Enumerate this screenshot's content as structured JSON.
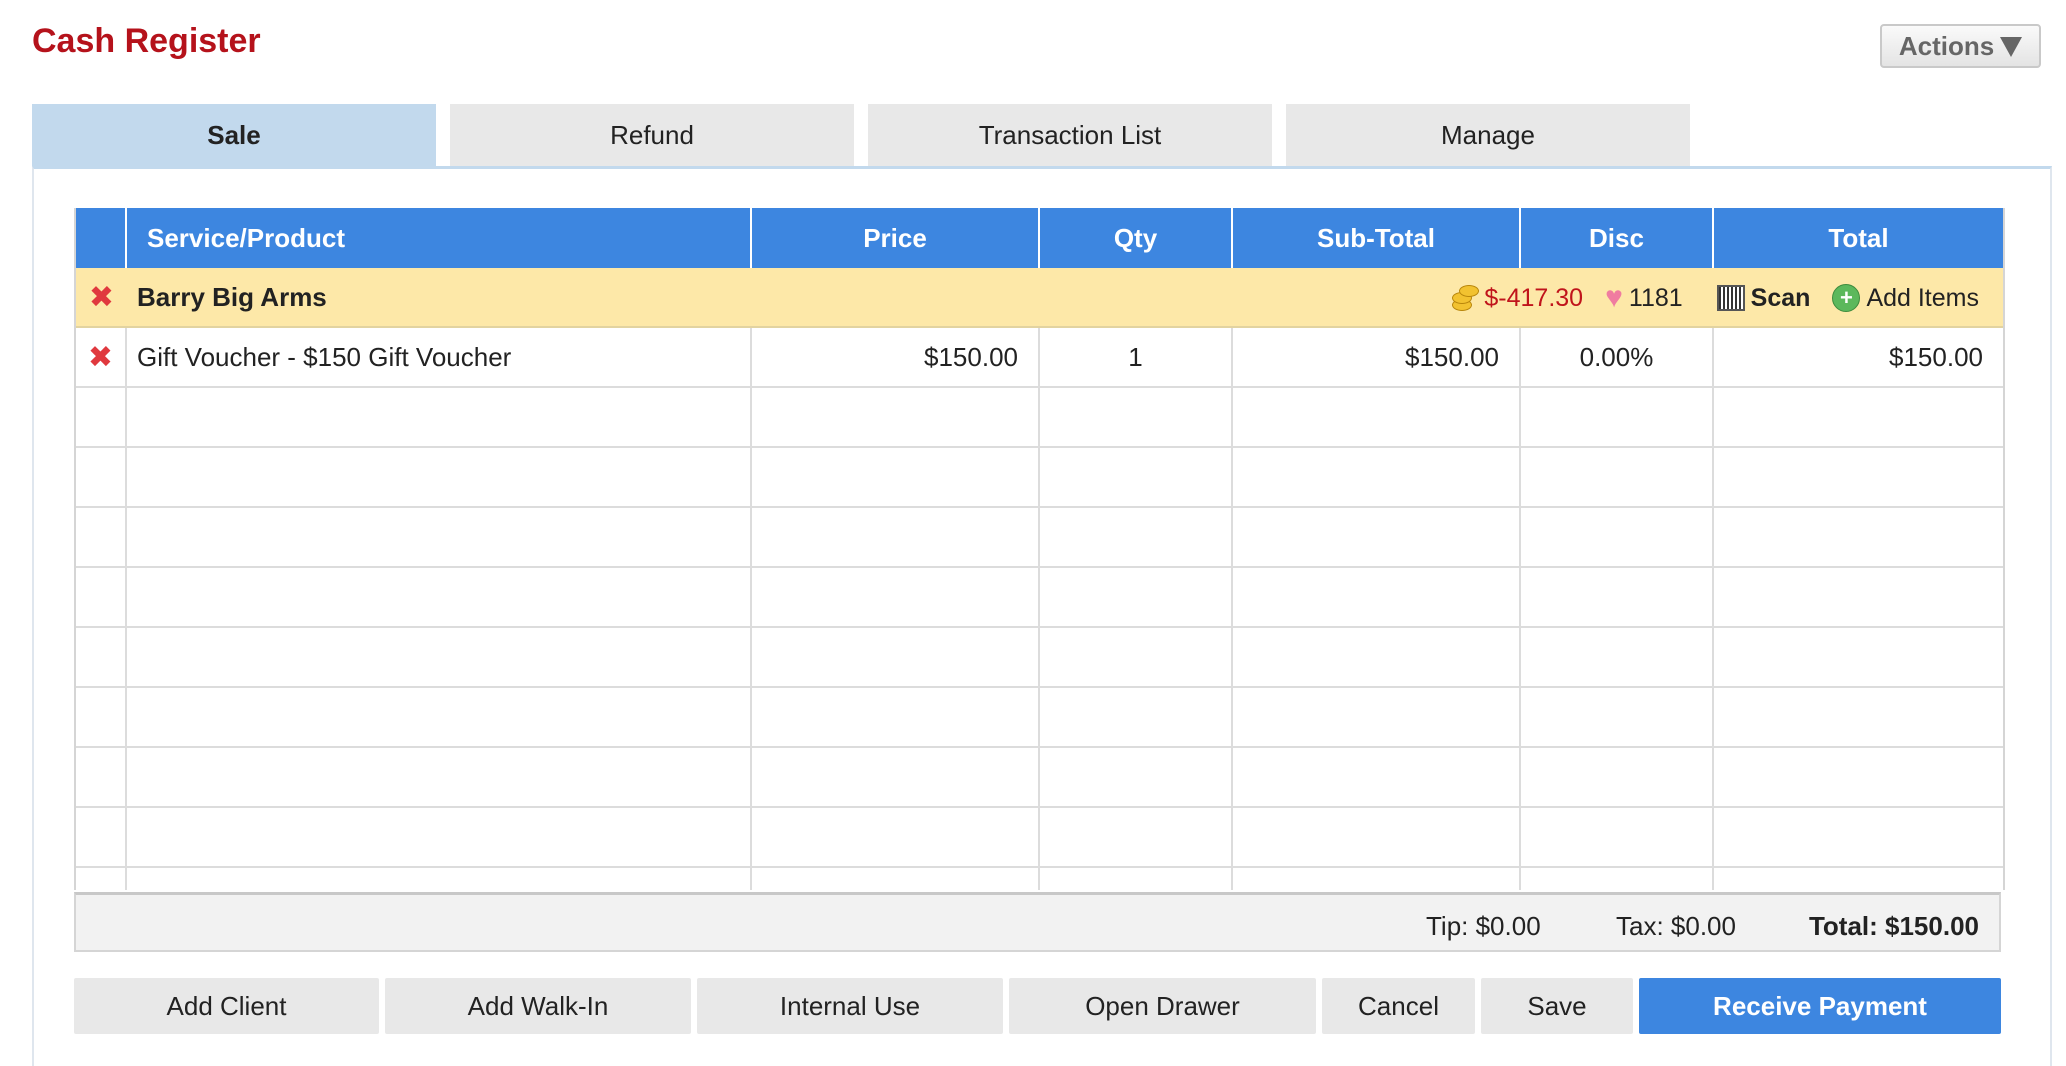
{
  "header": {
    "title": "Cash Register",
    "actions_label": "Actions"
  },
  "tabs": [
    {
      "label": "Sale",
      "active": true
    },
    {
      "label": "Refund",
      "active": false
    },
    {
      "label": "Transaction List",
      "active": false
    },
    {
      "label": "Manage",
      "active": false
    }
  ],
  "table": {
    "columns": [
      "Service/Product",
      "Price",
      "Qty",
      "Sub-Total",
      "Disc",
      "Total"
    ],
    "client": {
      "name": "Barry Big Arms",
      "balance": "$-417.30",
      "points": "1181",
      "scan_label": "Scan",
      "add_items_label": "Add Items"
    },
    "items": [
      {
        "product": "Gift Voucher - $150 Gift Voucher",
        "price": "$150.00",
        "qty": "1",
        "subtotal": "$150.00",
        "disc": "0.00%",
        "total": "$150.00"
      }
    ]
  },
  "totals": {
    "tip": "Tip: $0.00",
    "tax": "Tax: $0.00",
    "total": "Total: $150.00"
  },
  "buttons": {
    "add_client": "Add Client",
    "add_walkin": "Add Walk-In",
    "internal_use": "Internal Use",
    "open_drawer": "Open Drawer",
    "cancel": "Cancel",
    "save": "Save",
    "receive_payment": "Receive Payment"
  },
  "colors": {
    "title_red": "#b5121b",
    "header_blue": "#3d86e0",
    "client_row": "#fde8a8",
    "active_tab": "#c2d9ed",
    "balance_red": "#c0141b"
  },
  "icons": [
    "remove-icon",
    "coins-icon",
    "heart-icon",
    "barcode-icon",
    "plus-circle-icon",
    "dropdown-triangle-icon"
  ]
}
